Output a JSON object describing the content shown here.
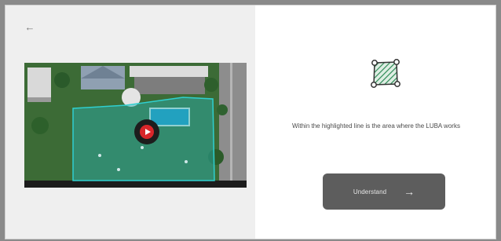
{
  "dialog": {
    "back_icon": "arrow-left-icon",
    "info_text": "Within the highlighted line is the area where the LUBA works",
    "area_icon": "hatched-area-icon",
    "play_icon": "play-icon",
    "button": {
      "label": "Understand",
      "arrow_icon": "arrow-right-icon"
    }
  },
  "colors": {
    "overlay": "#8a8a8a",
    "left_pane": "#efefef",
    "button_bg": "#5d5d5d",
    "play_red": "#d8262a",
    "highlight_area": "#27b3b3"
  }
}
